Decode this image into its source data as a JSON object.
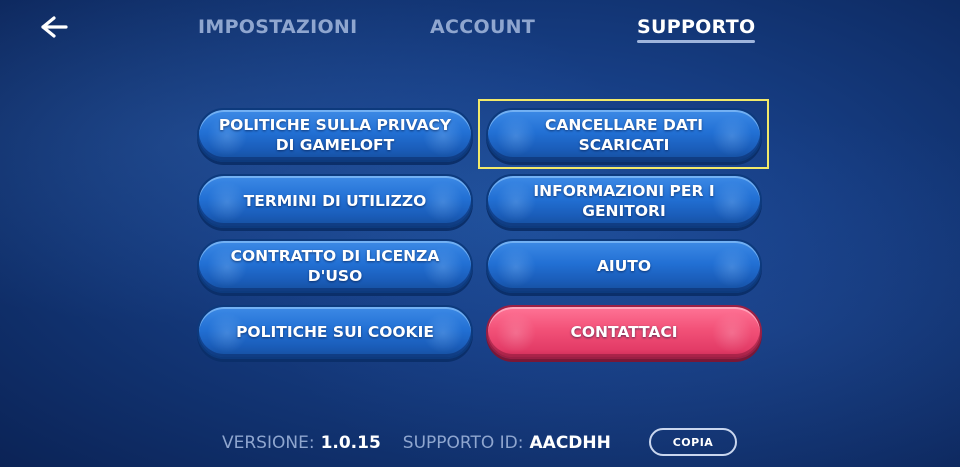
{
  "header": {
    "back_icon": "arrow-left-icon",
    "tabs": [
      {
        "label": "IMPOSTAZIONI",
        "active": false
      },
      {
        "label": "ACCOUNT",
        "active": false
      },
      {
        "label": "SUPPORTO",
        "active": true
      }
    ]
  },
  "buttons": {
    "privacy": "POLITICHE SULLA PRIVACY DI GAMELOFT",
    "clear_data": "CANCELLARE DATI SCARICATI",
    "terms": "TERMINI DI UTILIZZO",
    "parents": "INFORMAZIONI PER I GENITORI",
    "license": "CONTRATTO DI LICENZA D'USO",
    "help": "AIUTO",
    "cookies": "POLITICHE SUI COOKIE",
    "contact": "CONTATTACI"
  },
  "footer": {
    "version_label": "VERSIONE:",
    "version_value": "1.0.15",
    "support_label": "SUPPORTO ID:",
    "support_value": "AACDHH",
    "copy_label": "COPIA"
  },
  "colors": {
    "background": "#173f86",
    "button_blue": "#2270d4",
    "button_pink": "#f25178",
    "highlight": "#f2e96a",
    "inactive_text": "#8fa6cf"
  }
}
